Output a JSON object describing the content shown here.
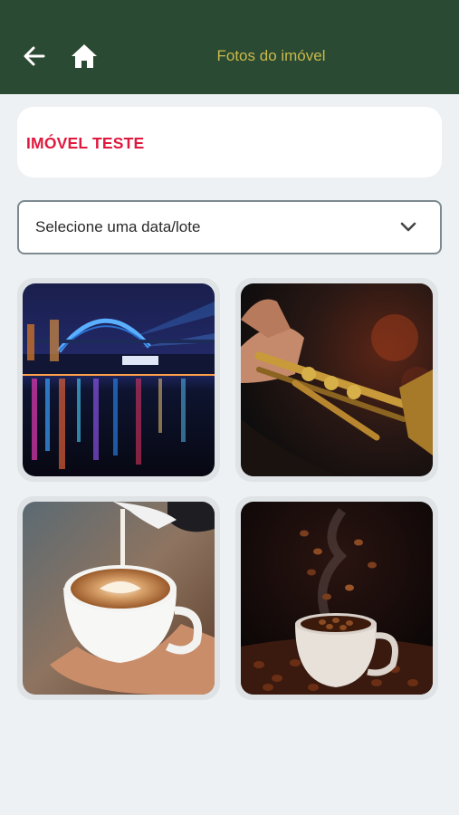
{
  "header": {
    "title": "Fotos do imóvel",
    "back_icon": "arrow-left-icon",
    "home_icon": "home-icon",
    "background": "#2b4a33",
    "title_color": "#c9b94a"
  },
  "property": {
    "name": "IMÓVEL TESTE",
    "name_color": "#e0193e"
  },
  "date_select": {
    "label": "Selecione uma data/lote",
    "icon": "chevron-down-icon"
  },
  "photos": [
    {
      "subject": "harbour-bridge-night"
    },
    {
      "subject": "trumpet"
    },
    {
      "subject": "latte-art"
    },
    {
      "subject": "coffee-beans-cup"
    }
  ]
}
